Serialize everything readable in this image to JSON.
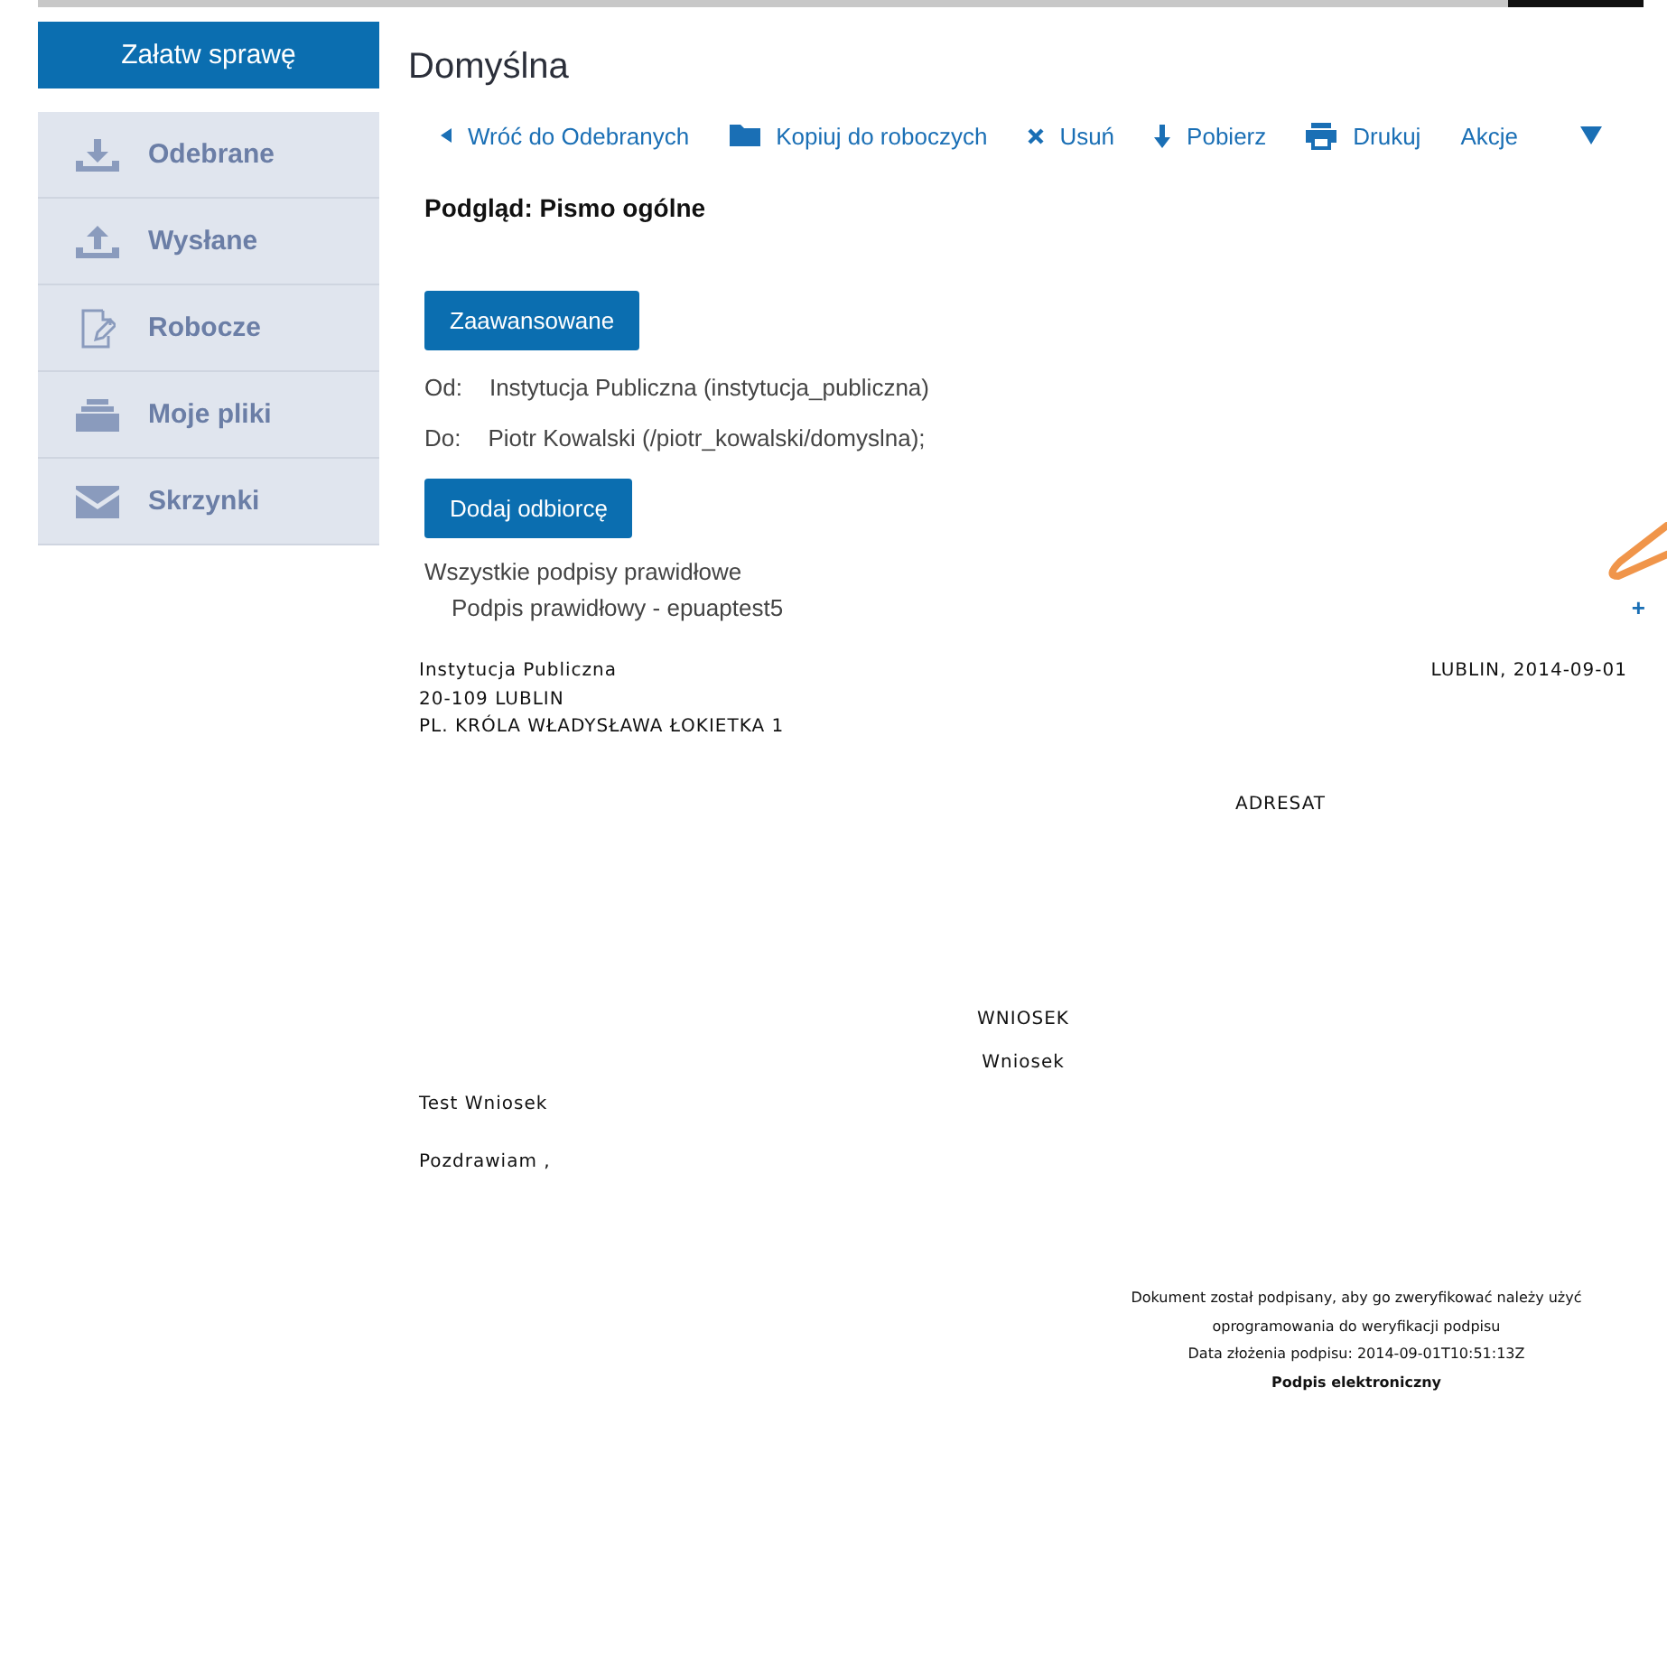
{
  "primary_button": "Załatw sprawę",
  "sidebar": {
    "items": [
      {
        "label": "Odebrane",
        "selected": false
      },
      {
        "label": "Wysłane",
        "selected": false
      },
      {
        "label": "Robocze",
        "selected": false
      },
      {
        "label": "Moje pliki",
        "selected": false
      },
      {
        "label": "Skrzynki",
        "selected": false
      }
    ]
  },
  "title": "Domyślna",
  "toolbar": [
    {
      "label": "Wróć do Odebranych"
    },
    {
      "label": "Kopiuj do roboczych"
    },
    {
      "label": "Usuń"
    },
    {
      "label": "Pobierz"
    },
    {
      "label": "Drukuj"
    },
    {
      "label": "Akcje"
    }
  ],
  "preview_title": "Podgląd: Pismo ogólne",
  "advanced_button": "Zaawansowane",
  "from": {
    "label": "Od:",
    "value": "Instytucja Publiczna (instytucja_publiczna)"
  },
  "to": {
    "label": "Do:",
    "value": "Piotr Kowalski (/piotr_kowalski/domyslna);"
  },
  "add_recipient_button": "Dodaj odbiorcę",
  "signatures": {
    "summary": "Wszystkie podpisy prawidłowe",
    "items": [
      "Podpis prawidłowy - epuaptest5"
    ],
    "expand": "+"
  },
  "letter": {
    "sender_lines": [
      "Instytucja Publiczna",
      "20-109 LUBLIN",
      "PL. KRÓLA WŁADYSŁAWA ŁOKIETKA 1"
    ],
    "place_date": "LUBLIN, 2014-09-01",
    "addressee": "ADRESAT",
    "heading": "WNIOSEK",
    "subject": "Wniosek",
    "body": [
      "Test Wniosek",
      "Pozdrawiam ,"
    ],
    "signature_note": [
      "Dokument został podpisany, aby go zweryfikować należy użyć",
      "oprogramowania do weryfikacji podpisu",
      "Data złożenia podpisu: 2014-09-01T10:51:13Z"
    ],
    "signature_label": "Podpis elektroniczny"
  }
}
